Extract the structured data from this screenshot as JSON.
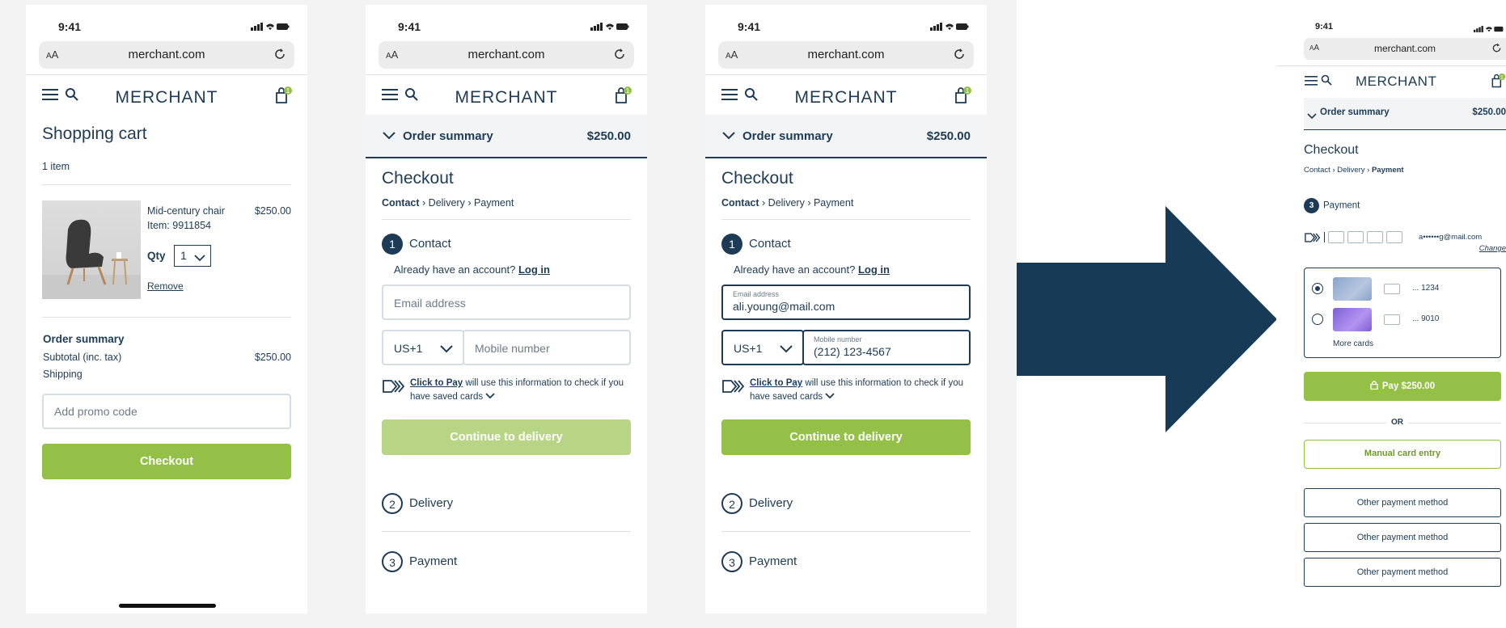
{
  "status": {
    "time": "9:41"
  },
  "browser": {
    "aa_big": "A",
    "aa_small": "A",
    "url": "merchant.com"
  },
  "brand": "MERCHANT",
  "cart_badge": "1",
  "cart": {
    "title": "Shopping cart",
    "count": "1 item",
    "product": {
      "name": "Mid-century chair",
      "item_no": "Item: 9911854",
      "price": "$250.00"
    },
    "qty_label": "Qty",
    "qty_value": "1",
    "remove": "Remove",
    "summary_title": "Order summary",
    "subtotal_label": "Subtotal (inc. tax)",
    "subtotal_value": "$250.00",
    "shipping_label": "Shipping",
    "promo_placeholder": "Add promo code",
    "checkout_button": "Checkout"
  },
  "checkout": {
    "summary_label": "Order summary",
    "summary_amount": "$250.00",
    "title": "Checkout",
    "crumb_contact": "Contact",
    "crumb_delivery": "Delivery",
    "crumb_payment": "Payment",
    "step1_num": "1",
    "step1_label": "Contact",
    "account_prompt": "Already have an account?",
    "login": "Log in",
    "email_placeholder": "Email address",
    "country_code": "US+1",
    "mobile_placeholder": "Mobile number",
    "ctp_name": "Click to Pay",
    "ctp_text": " will use this information to check if you have saved cards",
    "continue_button": "Continue to delivery",
    "step2_num": "2",
    "step2_label": "Delivery",
    "step3_num": "3",
    "step3_label": "Payment",
    "email_label": "Email address",
    "email_value": "ali.young@mail.com",
    "mobile_label": "Mobile number",
    "mobile_value": "(212) 123-4567"
  },
  "payment": {
    "summary_label": "Order summary",
    "summary_amount": "$250.00",
    "title": "Checkout",
    "crumb_contact": "Contact",
    "crumb_delivery": "Delivery",
    "crumb_payment": "Payment",
    "step_num": "3",
    "step_label": "Payment",
    "masked_email": "a••••••g@mail.com",
    "change": "Change",
    "card1_last4": "... 1234",
    "card2_last4": "... 9010",
    "more_cards": "More cards",
    "pay_button": "Pay $250.00",
    "or": "OR",
    "manual_entry": "Manual card entry",
    "other_methods": [
      "Other payment method",
      "Other payment method",
      "Other payment method"
    ]
  },
  "colors": {
    "navy": "#1d3b55",
    "green": "#94c047",
    "green_disabled": "#b8d586",
    "arrow": "#173a57"
  }
}
